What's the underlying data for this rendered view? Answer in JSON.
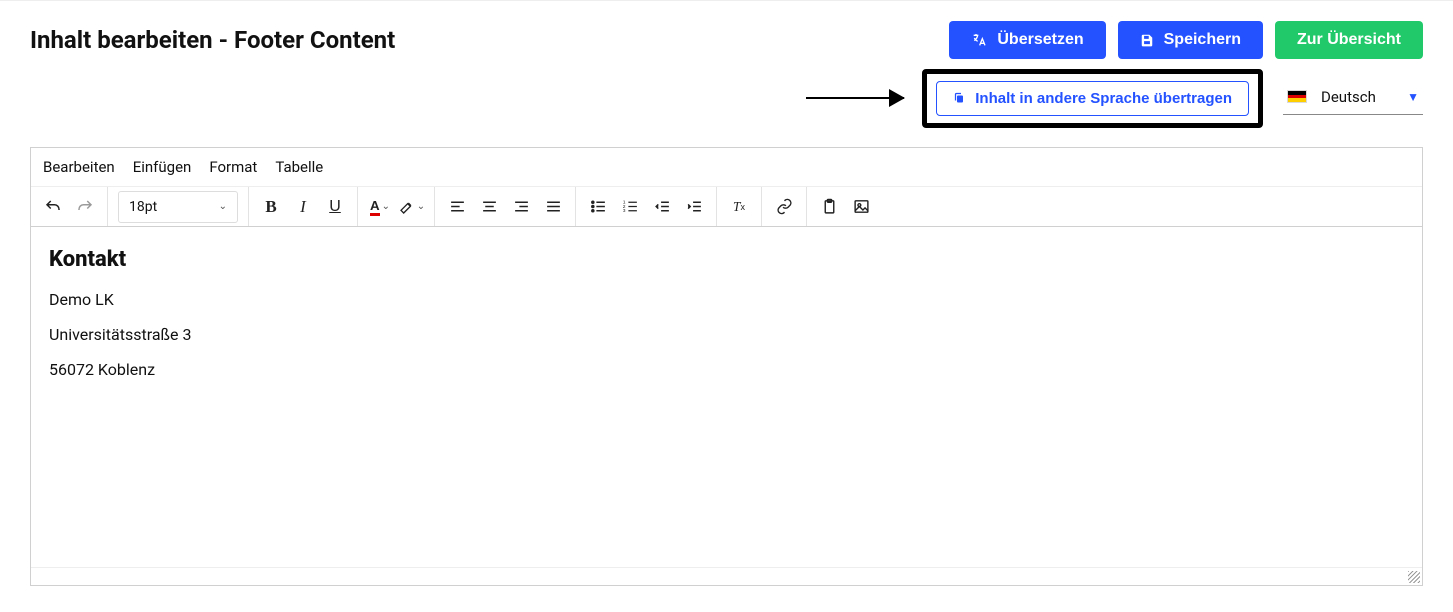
{
  "header": {
    "title": "Inhalt bearbeiten - Footer Content",
    "buttons": {
      "translate": "Übersetzen",
      "save": "Speichern",
      "overview": "Zur Übersicht"
    }
  },
  "subrow": {
    "copy_lang_button": "Inhalt in andere Sprache übertragen",
    "language": "Deutsch"
  },
  "editor": {
    "menus": {
      "edit": "Bearbeiten",
      "insert": "Einfügen",
      "format": "Format",
      "table": "Tabelle"
    },
    "fontsize": "18pt",
    "content": {
      "heading": "Kontakt",
      "p1": "Demo LK",
      "p2": "Universitätsstraße 3",
      "p3": "56072 Koblenz"
    }
  },
  "icons": {
    "translate": "translate-icon",
    "save": "save-icon",
    "copy": "copy-icon"
  }
}
